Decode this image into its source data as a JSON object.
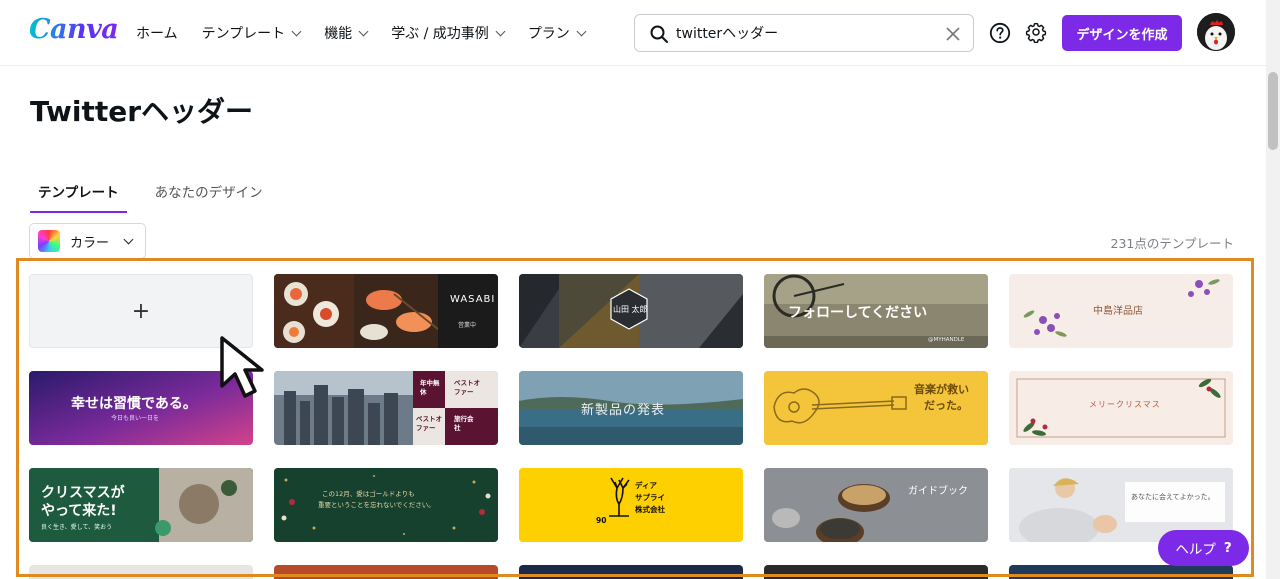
{
  "header": {
    "logo": "Canva",
    "nav": [
      {
        "label": "ホーム",
        "has_menu": false
      },
      {
        "label": "テンプレート",
        "has_menu": true
      },
      {
        "label": "機能",
        "has_menu": true
      },
      {
        "label": "学ぶ / 成功事例",
        "has_menu": true
      },
      {
        "label": "プラン",
        "has_menu": true
      }
    ],
    "search": {
      "value": "twitterヘッダー"
    },
    "create_button": "デザインを作成"
  },
  "page": {
    "title": "Twitterヘッダー",
    "tabs": [
      {
        "label": "テンプレート",
        "active": true
      },
      {
        "label": "あなたのデザイン",
        "active": false
      }
    ],
    "color_filter": "カラー",
    "template_count": "231点のテンプレート"
  },
  "templates": {
    "blank": "+",
    "t2": {
      "brand": "WASABI",
      "sub": "営業中"
    },
    "t3": {
      "name": "山田 太郎"
    },
    "t4": {
      "text": "フォローしてください",
      "handle": "@MYHANDLE"
    },
    "t5": {
      "name": "中島洋品店"
    },
    "t6": {
      "main": "幸せは習慣である。",
      "sub": "今日も良い一日を"
    },
    "t7": {
      "a": "年中無休",
      "b": "ベストオファー",
      "c": "ベストオファー",
      "d": "旅行会社"
    },
    "t8": {
      "text": "新製品の発表"
    },
    "t9": {
      "l1": "音楽が救い",
      "l2": "だった。"
    },
    "t10": {
      "text": "メリークリスマス"
    },
    "t11": {
      "l1": "クリスマスが",
      "l2": "やって来た!",
      "sub": "良く生き、愛して、笑おう"
    },
    "t12": {
      "l1": "この12月、愛はゴールドよりも",
      "l2": "重要ということを忘れないでください。"
    },
    "t13": {
      "l1": "ディア",
      "l2": "サプライ",
      "l3": "株式会社",
      "num": "90"
    },
    "t14": {
      "title": "ガイドブック"
    },
    "t15": {
      "l1": "あなたに会えてよかった。"
    }
  },
  "help_button": {
    "label": "ヘルプ",
    "icon": "?"
  },
  "colors": {
    "accent": "#7d2ae8",
    "highlight": "#e08a22"
  }
}
